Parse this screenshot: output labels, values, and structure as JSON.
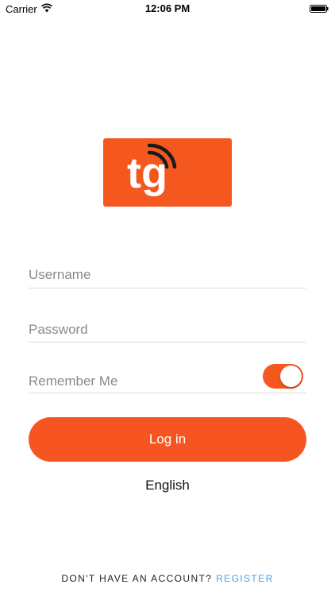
{
  "status_bar": {
    "carrier": "Carrier",
    "time": "12:06 PM"
  },
  "logo": {
    "text": "tg",
    "brand_color": "#f4581f"
  },
  "form": {
    "username_placeholder": "Username",
    "password_placeholder": "Password",
    "remember_label": "Remember Me",
    "remember_on": true,
    "login_label": "Log in"
  },
  "language": "English",
  "footer": {
    "prompt": "DON'T HAVE AN ACCOUNT?",
    "register_label": "REGISTER"
  },
  "colors": {
    "accent": "#f65522",
    "link": "#4aa3df"
  }
}
